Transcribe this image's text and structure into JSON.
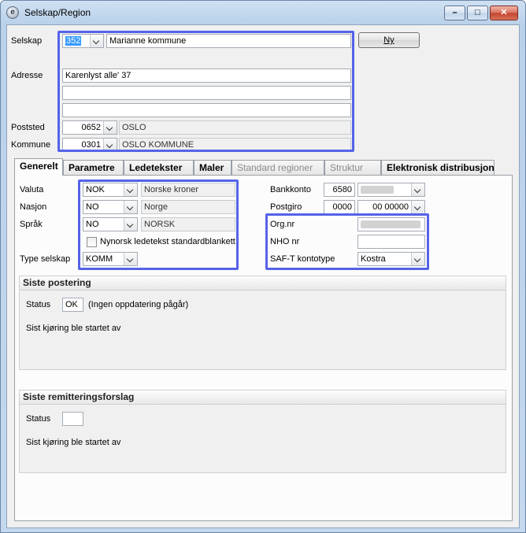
{
  "window": {
    "title": "Selskap/Region"
  },
  "header": {
    "selskap_label": "Selskap",
    "selskap_code": "352",
    "selskap_name": "Marianne kommune",
    "ny_button": "Ny",
    "adresse_label": "Adresse",
    "adresse_lines": [
      "Karenlyst alle' 37",
      "",
      ""
    ],
    "poststed_label": "Poststed",
    "poststed_code": "0652",
    "poststed_name": "OSLO",
    "kommune_label": "Kommune",
    "kommune_code": "0301",
    "kommune_name": "OSLO KOMMUNE"
  },
  "tabs": [
    {
      "label": "Generelt",
      "active": true
    },
    {
      "label": "Parametre"
    },
    {
      "label": "Ledetekster"
    },
    {
      "label": "Maler"
    },
    {
      "label": "Standard regioner",
      "disabled": true
    },
    {
      "label": "Struktur",
      "disabled": true
    },
    {
      "label": "Elektronisk distribusjon"
    }
  ],
  "generelt": {
    "valuta_label": "Valuta",
    "valuta_code": "NOK",
    "valuta_name": "Norske kroner",
    "nasjon_label": "Nasjon",
    "nasjon_code": "NO",
    "nasjon_name": "Norge",
    "sprak_label": "Språk",
    "sprak_code": "NO",
    "sprak_name": "NORSK",
    "nynorsk_checkbox_label": "Nynorsk ledetekst standardblankett",
    "type_selskap_label": "Type selskap",
    "type_selskap_value": "KOMM",
    "bankkonto_label": "Bankkonto",
    "bankkonto_value": "6580",
    "postgiro_label": "Postgiro",
    "postgiro_value_1": "0000",
    "postgiro_value_2": "00 00000",
    "orgnr_label": "Org.nr",
    "nhonr_label": "NHO nr",
    "saft_label": "SAF-T kontotype",
    "saft_value": "Kostra"
  },
  "siste_postering": {
    "title": "Siste postering",
    "status_label": "Status",
    "status_value": "OK",
    "status_text": "(Ingen oppdatering pågår)",
    "sist_kjoring_text": "Sist kjøring ble startet av"
  },
  "siste_remittering": {
    "title": "Siste remitteringsforslag",
    "status_label": "Status",
    "status_value": "",
    "sist_kjoring_text": "Sist kjøring ble startet av"
  },
  "colors": {
    "highlight": "#5563e8",
    "selection": "#3399ff"
  }
}
